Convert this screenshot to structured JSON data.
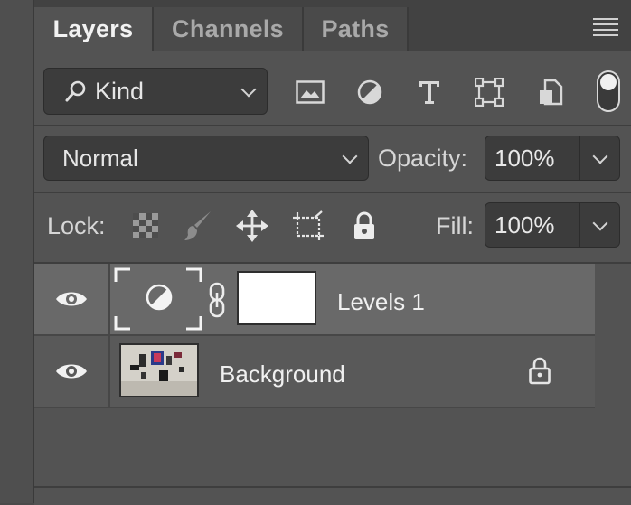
{
  "tabs": [
    {
      "label": "Layers",
      "active": true
    },
    {
      "label": "Channels",
      "active": false
    },
    {
      "label": "Paths",
      "active": false
    }
  ],
  "filter": {
    "kind_label": "Kind",
    "icons": [
      "image-filter-icon",
      "adjustment-filter-icon",
      "type-filter-icon",
      "shape-filter-icon",
      "smart-object-filter-icon"
    ]
  },
  "blend": {
    "mode": "Normal",
    "opacity_label": "Opacity:",
    "opacity_value": "100%"
  },
  "lock": {
    "label": "Lock:",
    "fill_label": "Fill:",
    "fill_value": "100%"
  },
  "layers": [
    {
      "name": "Levels 1",
      "selected": true,
      "visible": true,
      "type": "adjustment"
    },
    {
      "name": "Background",
      "selected": false,
      "visible": true,
      "locked": true,
      "type": "image"
    }
  ],
  "colors": {
    "panel_bg": "#535353",
    "tab_bar": "#424242",
    "selected_row": "#696969",
    "field_bg": "#3c3c3c"
  }
}
